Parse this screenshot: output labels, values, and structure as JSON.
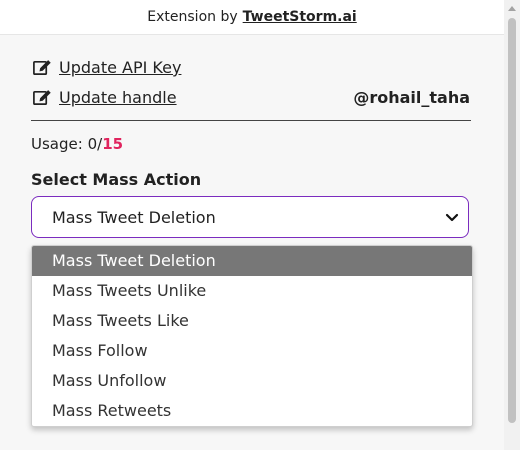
{
  "header": {
    "prefix": "Extension by",
    "brand": "TweetStorm.ai"
  },
  "links": {
    "update_api_key": "Update API Key",
    "update_handle": "Update handle"
  },
  "user": {
    "handle": "@rohail_taha"
  },
  "usage": {
    "label": "Usage:",
    "used": "0/",
    "limit": "15"
  },
  "section": {
    "title": "Select Mass Action"
  },
  "select": {
    "selected": "Mass Tweet Deletion",
    "options": [
      "Mass Tweet Deletion",
      "Mass Tweets Unlike",
      "Mass Tweets Like",
      "Mass Follow",
      "Mass Unfollow",
      "Mass Retweets"
    ]
  },
  "colors": {
    "accent": "#7b2cbf",
    "usage_limit": "#e0245e",
    "highlight": "#777777"
  }
}
